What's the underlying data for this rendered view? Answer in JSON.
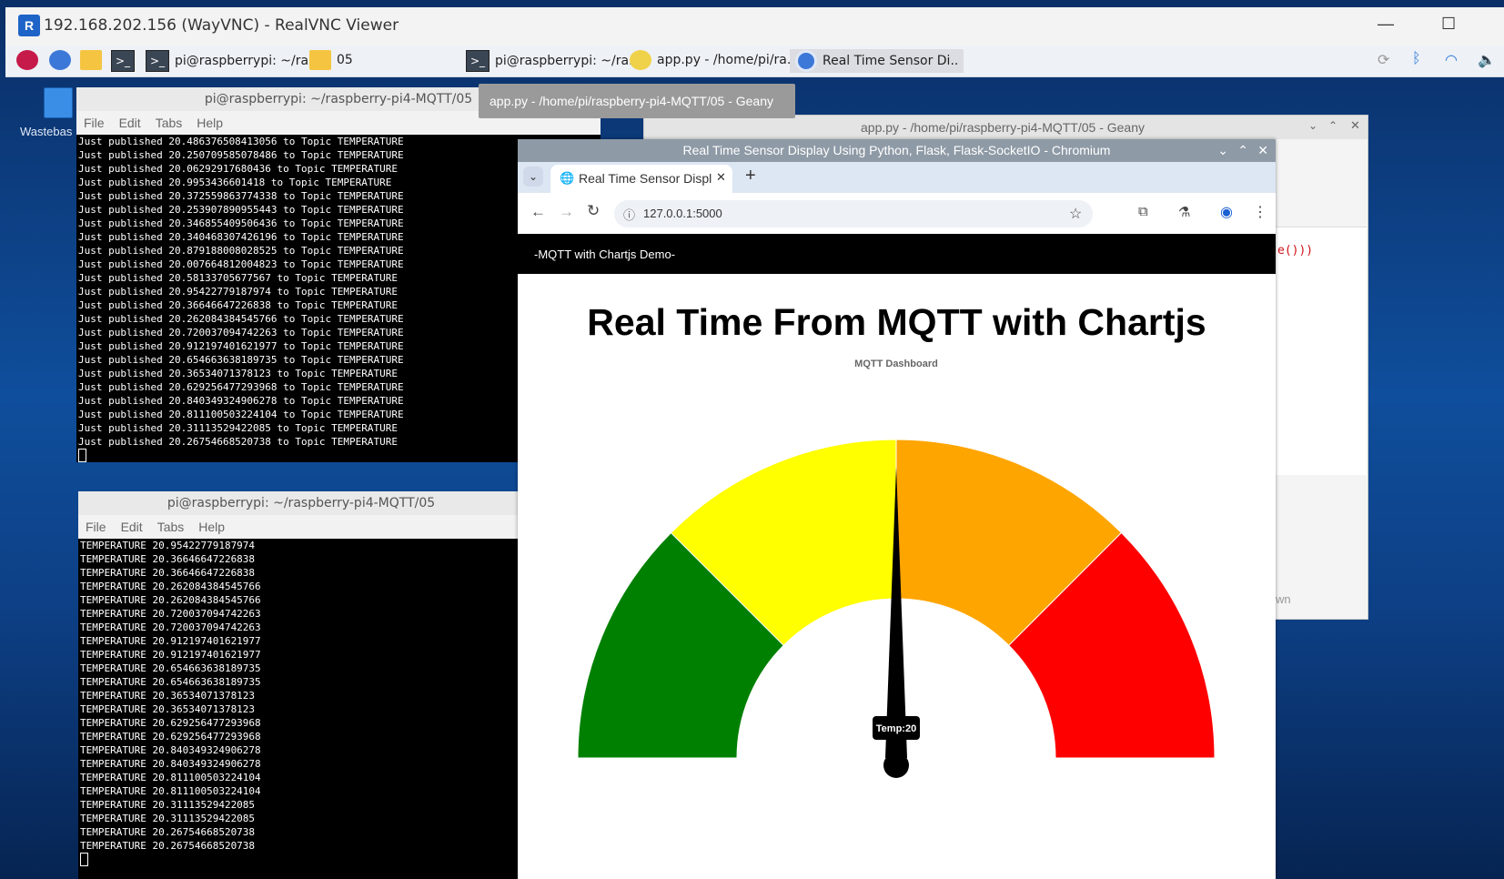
{
  "vnc": {
    "title": "192.168.202.156 (WayVNC) - RealVNC Viewer",
    "icon_label": "R"
  },
  "taskbar": {
    "items": [
      {
        "label": "pi@raspberrypi: ~/ra.."
      },
      {
        "label": "05"
      },
      {
        "label": "pi@raspberrypi: ~/ra.."
      },
      {
        "label": "app.py - /home/pi/ra.."
      },
      {
        "label": "Real Time Sensor Di.."
      }
    ]
  },
  "desktop": {
    "wastebasket_label": "Wastebas"
  },
  "tooltip": {
    "text": "app.py - /home/pi/raspberry-pi4-MQTT/05 - Geany"
  },
  "term1": {
    "title": "pi@raspberrypi: ~/raspberry-pi4-MQTT/05",
    "menu": [
      "File",
      "Edit",
      "Tabs",
      "Help"
    ],
    "lines": [
      "Just published 20.486376508413056 to Topic TEMPERATURE",
      "Just published 20.250709585078486 to Topic TEMPERATURE",
      "Just published 20.06292917680436 to Topic TEMPERATURE",
      "Just published 20.9953436601418 to Topic TEMPERATURE",
      "Just published 20.372559863774338 to Topic TEMPERATURE",
      "Just published 20.253907890955443 to Topic TEMPERATURE",
      "Just published 20.346855409506436 to Topic TEMPERATURE",
      "Just published 20.340468307426196 to Topic TEMPERATURE",
      "Just published 20.879188008028525 to Topic TEMPERATURE",
      "Just published 20.007664812004823 to Topic TEMPERATURE",
      "Just published 20.58133705677567 to Topic TEMPERATURE",
      "Just published 20.95422779187974 to Topic TEMPERATURE",
      "Just published 20.36646647226838 to Topic TEMPERATURE",
      "Just published 20.262084384545766 to Topic TEMPERATURE",
      "Just published 20.720037094742263 to Topic TEMPERATURE",
      "Just published 20.912197401621977 to Topic TEMPERATURE",
      "Just published 20.654663638189735 to Topic TEMPERATURE",
      "Just published 20.36534071378123 to Topic TEMPERATURE",
      "Just published 20.629256477293968 to Topic TEMPERATURE",
      "Just published 20.840349324906278 to Topic TEMPERATURE",
      "Just published 20.811100503224104 to Topic TEMPERATURE",
      "Just published 20.31113529422085 to Topic TEMPERATURE",
      "Just published 20.26754668520738 to Topic TEMPERATURE"
    ]
  },
  "term2": {
    "title": "pi@raspberrypi: ~/raspberry-pi4-MQTT/05",
    "menu": [
      "File",
      "Edit",
      "Tabs",
      "Help"
    ],
    "lines": [
      "TEMPERATURE 20.95422779187974",
      "TEMPERATURE 20.36646647226838",
      "TEMPERATURE 20.36646647226838",
      "TEMPERATURE 20.262084384545766",
      "TEMPERATURE 20.262084384545766",
      "TEMPERATURE 20.720037094742263",
      "TEMPERATURE 20.720037094742263",
      "TEMPERATURE 20.912197401621977",
      "TEMPERATURE 20.912197401621977",
      "TEMPERATURE 20.654663638189735",
      "TEMPERATURE 20.654663638189735",
      "TEMPERATURE 20.36534071378123",
      "TEMPERATURE 20.36534071378123",
      "TEMPERATURE 20.629256477293968",
      "TEMPERATURE 20.629256477293968",
      "TEMPERATURE 20.840349324906278",
      "TEMPERATURE 20.840349324906278",
      "TEMPERATURE 20.811100503224104",
      "TEMPERATURE 20.811100503224104",
      "TEMPERATURE 20.31113529422085",
      "TEMPERATURE 20.31113529422085",
      "TEMPERATURE 20.26754668520738",
      "TEMPERATURE 20.26754668520738"
    ]
  },
  "geany": {
    "title": "app.py - /home/pi/raspberry-pi4-MQTT/05 - Geany",
    "code_snippet": "e()))",
    "status_snippet": "wn"
  },
  "chromium": {
    "window_title": "Real Time Sensor Display Using Python, Flask, Flask-SocketIO - Chromium",
    "tab_title": "Real Time Sensor Displ",
    "url": "127.0.0.1:5000"
  },
  "page": {
    "nav_brand": "-MQTT with Chartjs Demo-",
    "heading": "Real Time From MQTT with Chartjs"
  },
  "chart_data": {
    "type": "gauge",
    "title": "MQTT Dashboard",
    "value": 20,
    "value_label": "Temp:20",
    "segments": [
      {
        "from": 0,
        "to": 10,
        "color": "#008000"
      },
      {
        "from": 10,
        "to": 20,
        "color": "#ffff00"
      },
      {
        "from": 20,
        "to": 30,
        "color": "#ffa500"
      },
      {
        "from": 30,
        "to": 40,
        "color": "#ff0000"
      }
    ],
    "min": 0,
    "max": 40
  },
  "colors": {
    "nav_bg": "#000000",
    "terminal_bg": "#000000",
    "needle": "#000000"
  }
}
